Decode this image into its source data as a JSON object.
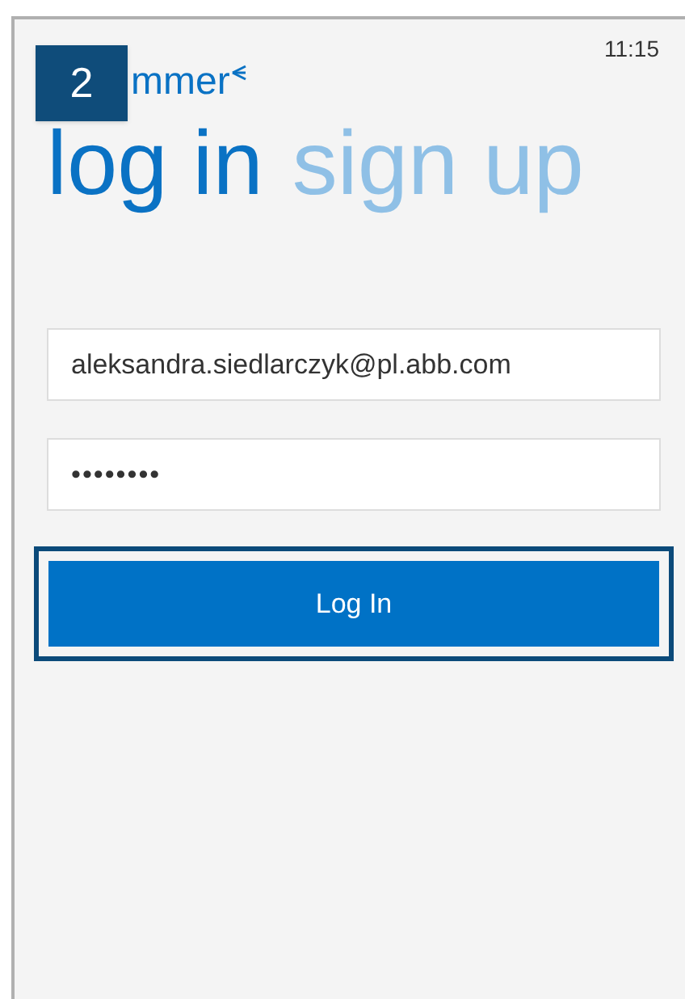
{
  "status_bar": {
    "time": "11:15"
  },
  "logo": {
    "text": "mmer"
  },
  "step_badge": {
    "text": "2"
  },
  "tabs": [
    {
      "label": "log in",
      "selected": true
    },
    {
      "label": "sign up",
      "selected": false
    }
  ],
  "form": {
    "email": {
      "value": "aleksandra.siedlarczyk@pl.abb.com"
    },
    "password": {
      "value": "••••••••"
    },
    "submit": {
      "label": "Log In",
      "highlighted": true
    }
  }
}
